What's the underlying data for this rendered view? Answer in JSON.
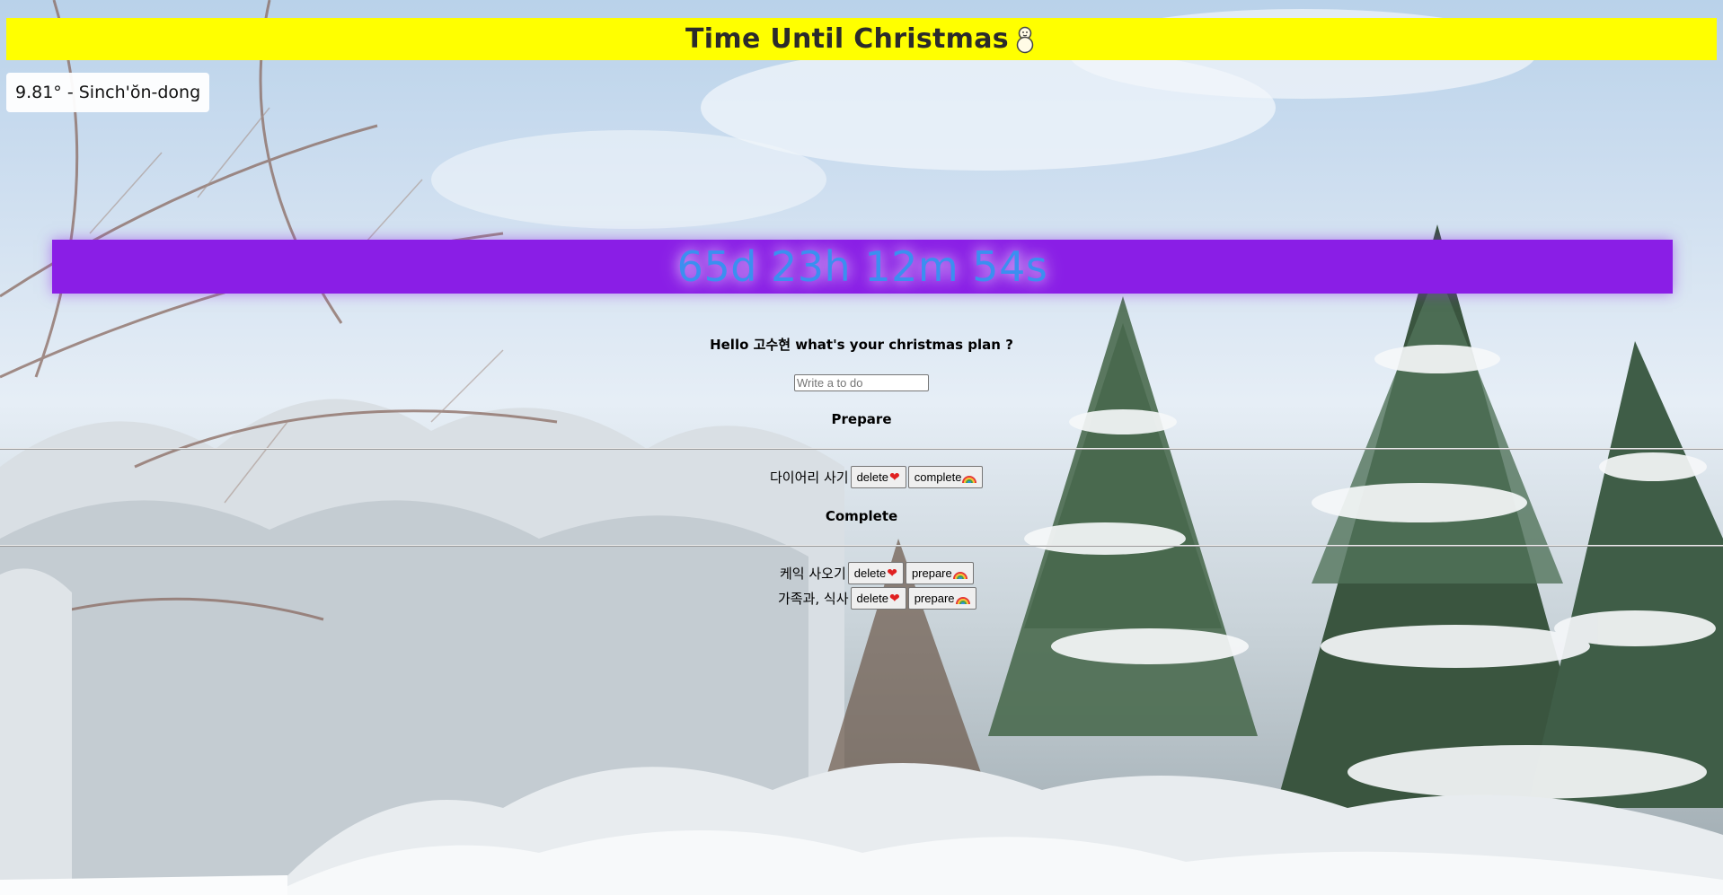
{
  "header": {
    "title": "Time Until Christmas",
    "title_icon": "snowman-icon",
    "bar_color": "#ffff00"
  },
  "weather": {
    "text": "9.81° - Sinch'ŏn-dong"
  },
  "countdown": {
    "text": "65d 23h 12m 54s",
    "bar_color": "#8a1ee6",
    "text_color": "#3b8ff0"
  },
  "greeting": {
    "text": "Hello 고수현 what's your christmas plan ?"
  },
  "todo_form": {
    "placeholder": "Write a to do"
  },
  "prepare_section": {
    "heading": "Prepare",
    "items": [
      {
        "label": "다이어리 사기",
        "delete_label": "delete",
        "delete_icon": "heart-icon",
        "action_label": "complete",
        "action_icon": "rainbow-icon"
      }
    ]
  },
  "complete_section": {
    "heading": "Complete",
    "items": [
      {
        "label": "케익 사오기",
        "delete_label": "delete",
        "delete_icon": "heart-icon",
        "action_label": "prepare",
        "action_icon": "rainbow-icon"
      },
      {
        "label": "가족과, 식사",
        "delete_label": "delete",
        "delete_icon": "heart-icon",
        "action_label": "prepare",
        "action_icon": "rainbow-icon"
      }
    ]
  },
  "background": {
    "scene_icon": "snowy-forest-background"
  }
}
